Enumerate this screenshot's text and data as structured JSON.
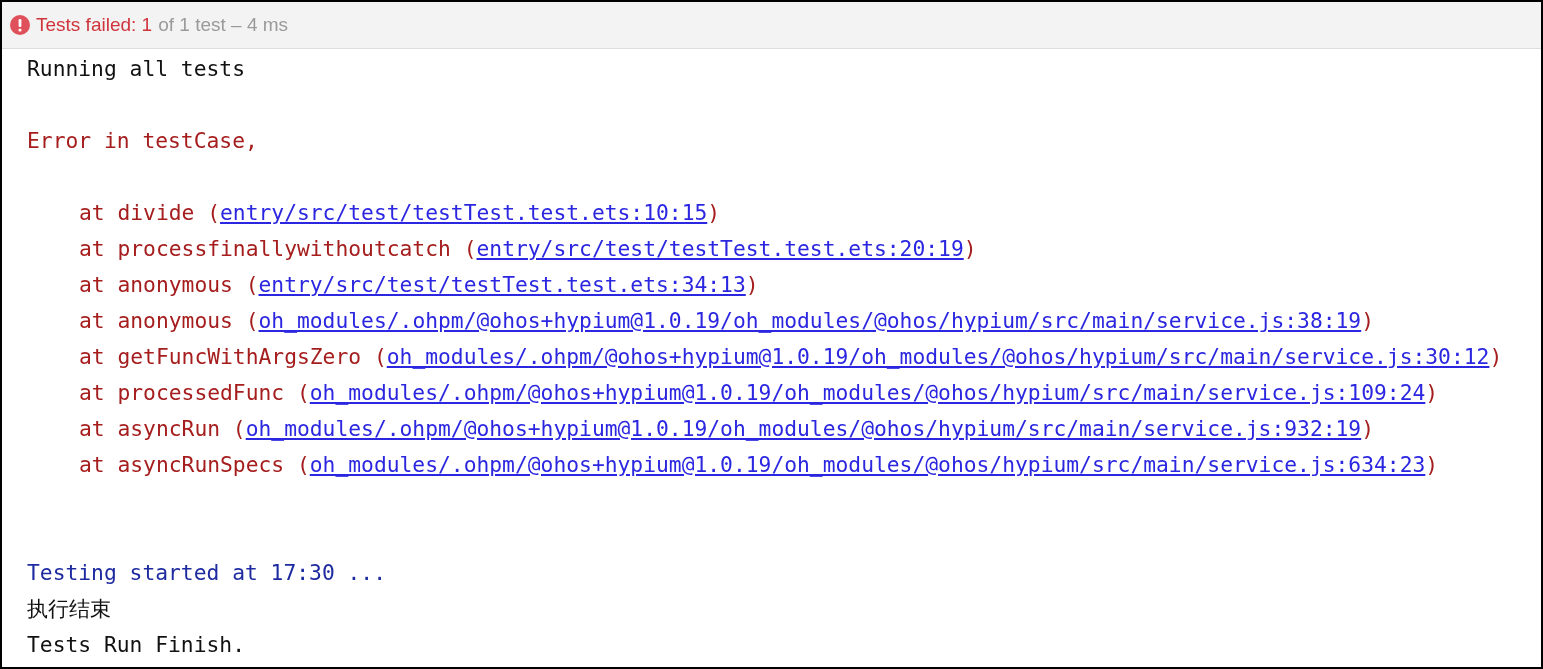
{
  "header": {
    "status": "Tests failed: 1",
    "summary": "of 1 test – 4 ms"
  },
  "lines": [
    {
      "kind": "plain",
      "text": "Running all tests"
    },
    {
      "kind": "error",
      "text": "Error in testCase,"
    },
    {
      "kind": "frame",
      "prefix": "at divide (",
      "link": "entry/src/test/testTest.test.ets:10:15",
      "suffix": ")"
    },
    {
      "kind": "frame",
      "prefix": "at processfinallywithoutcatch (",
      "link": "entry/src/test/testTest.test.ets:20:19",
      "suffix": ")"
    },
    {
      "kind": "frame",
      "prefix": "at anonymous (",
      "link": "entry/src/test/testTest.test.ets:34:13",
      "suffix": ")"
    },
    {
      "kind": "frame",
      "prefix": "at anonymous (",
      "link": "oh_modules/.ohpm/@ohos+hypium@1.0.19/oh_modules/@ohos/hypium/src/main/service.js:38:19",
      "suffix": ")"
    },
    {
      "kind": "frame",
      "prefix": "at getFuncWithArgsZero (",
      "link": "oh_modules/.ohpm/@ohos+hypium@1.0.19/oh_modules/@ohos/hypium/src/main/service.js:30:12",
      "suffix": ")"
    },
    {
      "kind": "frame",
      "prefix": "at processedFunc (",
      "link": "oh_modules/.ohpm/@ohos+hypium@1.0.19/oh_modules/@ohos/hypium/src/main/service.js:109:24",
      "suffix": ")"
    },
    {
      "kind": "frame",
      "prefix": "at asyncRun (",
      "link": "oh_modules/.ohpm/@ohos+hypium@1.0.19/oh_modules/@ohos/hypium/src/main/service.js:932:19",
      "suffix": ")"
    },
    {
      "kind": "frame",
      "prefix": "at asyncRunSpecs (",
      "link": "oh_modules/.ohpm/@ohos+hypium@1.0.19/oh_modules/@ohos/hypium/src/main/service.js:634:23",
      "suffix": ")"
    },
    {
      "kind": "info",
      "text": "Testing started at 17:30 ..."
    },
    {
      "kind": "plain",
      "text": "执行结束"
    },
    {
      "kind": "plain",
      "text": "Tests Run Finish."
    }
  ]
}
